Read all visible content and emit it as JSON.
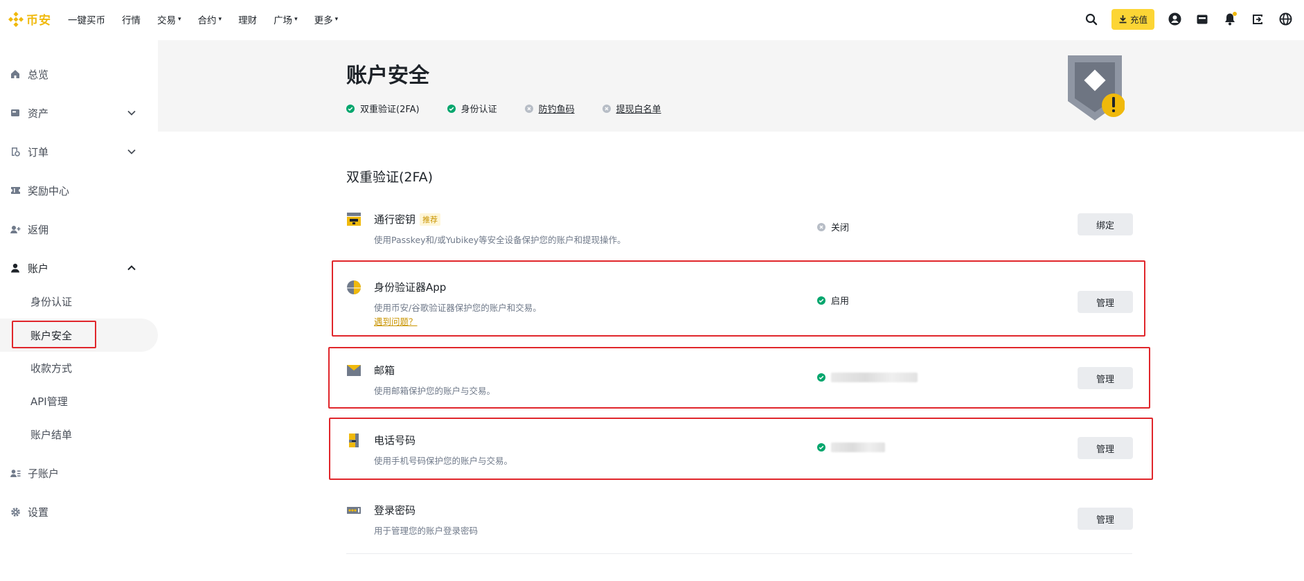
{
  "app": {
    "logo_text": "币安",
    "brand_color": "#f0b90b",
    "accent_color": "#fcd535"
  },
  "topnav": {
    "items": [
      {
        "label": "一键买币",
        "dropdown": false
      },
      {
        "label": "行情",
        "dropdown": false
      },
      {
        "label": "交易",
        "dropdown": true
      },
      {
        "label": "合约",
        "dropdown": true
      },
      {
        "label": "理财",
        "dropdown": false
      },
      {
        "label": "广场",
        "dropdown": true
      },
      {
        "label": "更多",
        "dropdown": true
      }
    ],
    "deposit_label": "充值",
    "icons": [
      "search-icon",
      "download-icon",
      "user-icon",
      "wallet-icon",
      "bell-icon",
      "download-app-icon",
      "globe-icon"
    ]
  },
  "sidebar": {
    "overview": "总览",
    "assets": "资产",
    "orders": "订单",
    "rewards": "奖励中心",
    "referral": "返佣",
    "account": "账户",
    "account_sub": [
      "身份认证",
      "账户安全",
      "收款方式",
      "API管理",
      "账户结单"
    ],
    "active_sub": "账户安全",
    "subaccount": "子账户",
    "settings": "设置"
  },
  "header": {
    "title": "账户安全",
    "checks": [
      {
        "label": "双重验证(2FA)",
        "state": "done"
      },
      {
        "label": "身份认证",
        "state": "done"
      },
      {
        "label": "防钓鱼码",
        "state": "todo"
      },
      {
        "label": "提现白名单",
        "state": "todo"
      }
    ],
    "shield_icon": "shield-warning-icon"
  },
  "section": {
    "title": "双重验证(2FA)",
    "rows": [
      {
        "name": "通行密钥",
        "badge": "推荐",
        "desc": "使用Passkey和/或Yubikey等安全设备保护您的账户和提现操作。",
        "status": "关闭",
        "status_state": "off",
        "button": "绑定",
        "icon": "passkey-icon"
      },
      {
        "name": "身份验证器App",
        "desc": "使用币安/谷歌验证器保护您的账户和交易。",
        "link": "遇到问题？",
        "status": "启用",
        "status_state": "on",
        "button": "管理",
        "icon": "authenticator-icon"
      },
      {
        "name": "邮箱",
        "desc": "使用邮箱保护您的账户与交易。",
        "status": "",
        "status_state": "on",
        "button": "管理",
        "icon": "email-icon"
      },
      {
        "name": "电话号码",
        "desc": "使用手机号码保护您的账户与交易。",
        "status": "",
        "status_state": "on",
        "button": "管理",
        "icon": "phone-icon"
      },
      {
        "name": "登录密码",
        "desc": "用于管理您的账户登录密码",
        "button": "管理",
        "icon": "password-icon"
      }
    ]
  },
  "colors": {
    "success": "#03a66d",
    "muted": "#b7bdc6",
    "highlight_box": "#e0262b"
  }
}
